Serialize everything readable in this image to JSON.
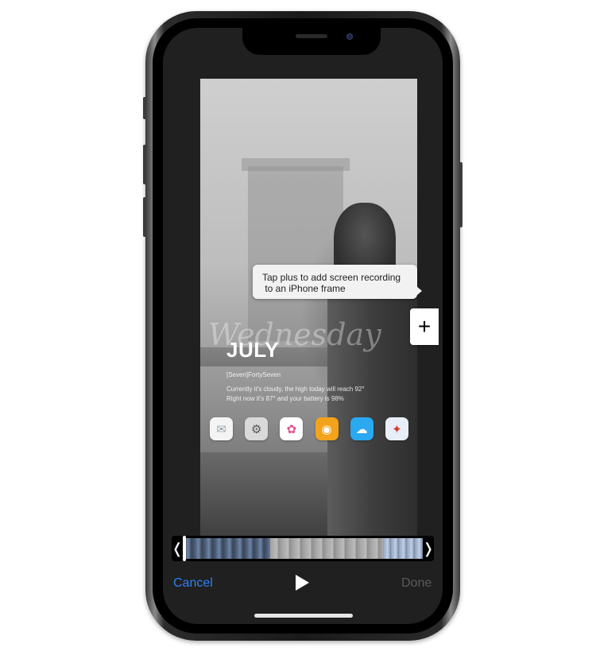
{
  "screen": {
    "wallpaper_script_text": "Wednesday",
    "month": "JULY",
    "signature": "[Seven]FortySeven",
    "weather_lines": [
      "Currently it's cloudy, the high today will reach 92°",
      "Right now it's 87° and your battery is 98%"
    ],
    "dock_icons": [
      {
        "name": "mail-icon",
        "glyph": "✉",
        "bg": "#f4f4f4",
        "fg": "#9aa3b2"
      },
      {
        "name": "settings-icon",
        "glyph": "⚙",
        "bg": "#d9d9d9",
        "fg": "#555555"
      },
      {
        "name": "photos-icon",
        "glyph": "✿",
        "bg": "#ffffff",
        "fg": "#e94b8a"
      },
      {
        "name": "ipod-icon",
        "glyph": "◉",
        "bg": "#f2a31b",
        "fg": "#ffffff"
      },
      {
        "name": "weather-icon",
        "glyph": "☁",
        "bg": "#2aa8f0",
        "fg": "#ffffff"
      },
      {
        "name": "compass-icon",
        "glyph": "✦",
        "bg": "#e8eef7",
        "fg": "#d33a2c"
      }
    ]
  },
  "tooltip": {
    "line1": "Tap plus to add screen recording",
    "line2": " to an iPhone frame"
  },
  "plus_button": {
    "glyph": "+"
  },
  "timeline": {
    "left_handle": "❬",
    "right_handle": "❭"
  },
  "controls": {
    "cancel": "Cancel",
    "done": "Done"
  },
  "colors": {
    "accent": "#2f7ff6",
    "disabled": "#5a5a5a"
  }
}
